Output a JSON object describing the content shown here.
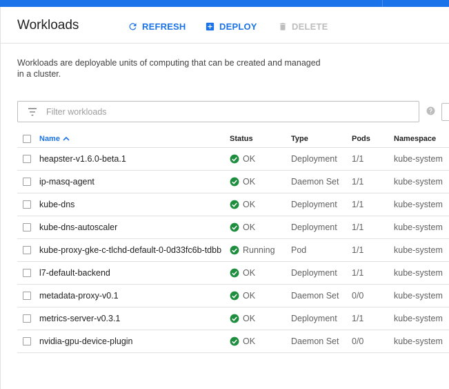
{
  "header": {
    "title": "Workloads",
    "refresh_label": "REFRESH",
    "deploy_label": "DEPLOY",
    "delete_label": "DELETE"
  },
  "description": "Workloads are deployable units of computing that can be created and managed in a cluster.",
  "filter": {
    "placeholder": "Filter workloads"
  },
  "table": {
    "columns": {
      "name": "Name",
      "status": "Status",
      "type": "Type",
      "pods": "Pods",
      "namespace": "Namespace"
    },
    "sort": "ascending",
    "rows": [
      {
        "name": "heapster-v1.6.0-beta.1",
        "status": "OK",
        "type": "Deployment",
        "pods": "1/1",
        "namespace": "kube-system"
      },
      {
        "name": "ip-masq-agent",
        "status": "OK",
        "type": "Daemon Set",
        "pods": "1/1",
        "namespace": "kube-system"
      },
      {
        "name": "kube-dns",
        "status": "OK",
        "type": "Deployment",
        "pods": "1/1",
        "namespace": "kube-system"
      },
      {
        "name": "kube-dns-autoscaler",
        "status": "OK",
        "type": "Deployment",
        "pods": "1/1",
        "namespace": "kube-system"
      },
      {
        "name": "kube-proxy-gke-c-tlchd-default-0-0d33fc6b-tdbb",
        "status": "Running",
        "type": "Pod",
        "pods": "1/1",
        "namespace": "kube-system"
      },
      {
        "name": "l7-default-backend",
        "status": "OK",
        "type": "Deployment",
        "pods": "1/1",
        "namespace": "kube-system"
      },
      {
        "name": "metadata-proxy-v0.1",
        "status": "OK",
        "type": "Daemon Set",
        "pods": "0/0",
        "namespace": "kube-system"
      },
      {
        "name": "metrics-server-v0.3.1",
        "status": "OK",
        "type": "Deployment",
        "pods": "1/1",
        "namespace": "kube-system"
      },
      {
        "name": "nvidia-gpu-device-plugin",
        "status": "OK",
        "type": "Daemon Set",
        "pods": "0/0",
        "namespace": "kube-system"
      }
    ]
  },
  "icons": {
    "refresh": "refresh-icon",
    "deploy": "add-box-icon",
    "delete": "trash-icon",
    "filter": "filter-list-icon",
    "help": "help-icon",
    "status_ok": "check-circle-icon",
    "sort": "chevron-up-icon"
  },
  "colors": {
    "accent": "#1a73e8",
    "ok_green": "#1e8e3e",
    "disabled": "#bdbdbd"
  }
}
